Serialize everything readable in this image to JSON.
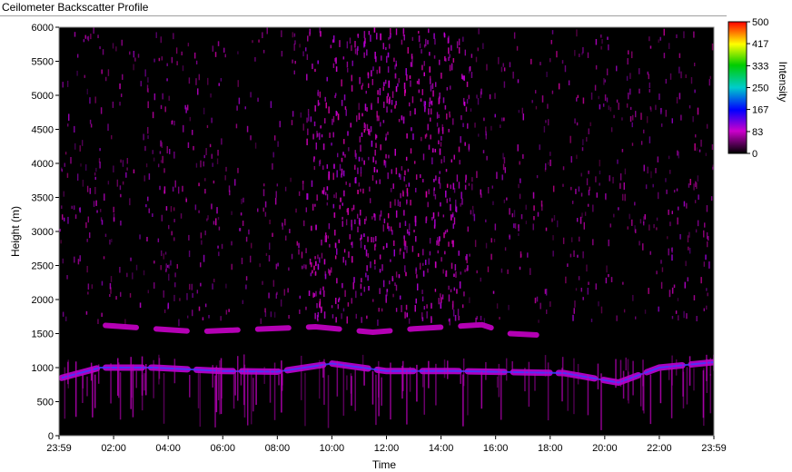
{
  "window": {
    "title": "Ceilometer Backscatter Profile"
  },
  "chart_data": {
    "type": "heatmap",
    "title": "Ceilometer Backscatter Profile",
    "xlabel": "Time",
    "ylabel": "Height (m)",
    "x_tick_labels": [
      "23:59",
      "02:00",
      "04:00",
      "06:00",
      "08:00",
      "10:00",
      "12:00",
      "14:00",
      "16:00",
      "18:00",
      "20:00",
      "22:00",
      "23:59"
    ],
    "x_hours": [
      0,
      2,
      4,
      6,
      8,
      10,
      12,
      14,
      16,
      18,
      20,
      22,
      24
    ],
    "xlim_hours": [
      0,
      24
    ],
    "y_tick_labels": [
      "0",
      "500",
      "1000",
      "1500",
      "2000",
      "2500",
      "3000",
      "3500",
      "4000",
      "4500",
      "5000",
      "5500",
      "6000"
    ],
    "y_ticks": [
      0,
      500,
      1000,
      1500,
      2000,
      2500,
      3000,
      3500,
      4000,
      4500,
      5000,
      5500,
      6000
    ],
    "ylim": [
      0,
      6000
    ],
    "colorbar": {
      "label": "Intensity",
      "tick_labels": [
        "500",
        "417",
        "333",
        "250",
        "167",
        "83",
        "0"
      ],
      "ticks": [
        500,
        417,
        333,
        250,
        167,
        83,
        0
      ],
      "range": [
        0,
        500
      ],
      "colors": [
        "#000000",
        "#cc00cc",
        "#0000ff",
        "#00cccc",
        "#00cc00",
        "#ffff00",
        "#ff0000"
      ]
    },
    "features": {
      "cloud_layer_upper": [
        {
          "t": 1.7,
          "h": 1620
        },
        {
          "t": 5.0,
          "h": 1530
        },
        {
          "t": 7.0,
          "h": 1560
        },
        {
          "t": 9.4,
          "h": 1600
        },
        {
          "t": 11.5,
          "h": 1520
        },
        {
          "t": 13.0,
          "h": 1570
        },
        {
          "t": 15.5,
          "h": 1630
        },
        {
          "t": 16.5,
          "h": 1500
        },
        {
          "t": 17.5,
          "h": 1480
        }
      ],
      "cloud_layer_lower": [
        {
          "t": 0.1,
          "h": 850
        },
        {
          "t": 1.5,
          "h": 1000
        },
        {
          "t": 3.5,
          "h": 1000
        },
        {
          "t": 6.0,
          "h": 950
        },
        {
          "t": 8.0,
          "h": 940
        },
        {
          "t": 10.0,
          "h": 1060
        },
        {
          "t": 12.0,
          "h": 950
        },
        {
          "t": 14.5,
          "h": 950
        },
        {
          "t": 18.5,
          "h": 920
        },
        {
          "t": 20.5,
          "h": 780
        },
        {
          "t": 22.0,
          "h": 1000
        },
        {
          "t": 24.0,
          "h": 1080
        }
      ],
      "residual_layer_top": 1700,
      "noise_band_hours": [
        9,
        15
      ]
    }
  }
}
